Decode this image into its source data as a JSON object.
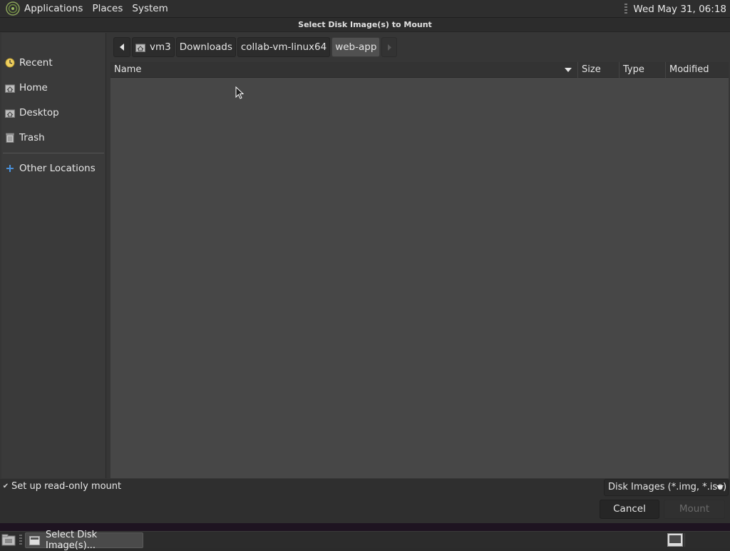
{
  "top_panel": {
    "menus": [
      "Applications",
      "Places",
      "System"
    ],
    "clock": "Wed May 31, 06:18"
  },
  "dialog": {
    "title": "Select Disk Image(s) to Mount",
    "sidebar": {
      "items": [
        {
          "label": "Recent",
          "icon": "recent-icon"
        },
        {
          "label": "Home",
          "icon": "home-folder-icon"
        },
        {
          "label": "Desktop",
          "icon": "desktop-folder-icon"
        },
        {
          "label": "Trash",
          "icon": "trash-icon"
        },
        {
          "label": "Other Locations",
          "icon": "plus-icon"
        }
      ]
    },
    "pathbar": {
      "segments": [
        "vm3",
        "Downloads",
        "collab-vm-linux64",
        "web-app"
      ],
      "active": "web-app"
    },
    "file_list": {
      "columns": [
        "Name",
        "Size",
        "Type",
        "Modified"
      ],
      "rows": []
    },
    "readonly_checkbox": {
      "label": "Set up read-only mount",
      "checked": true
    },
    "filter": {
      "selected": "Disk Images (*.img, *.iso)"
    },
    "buttons": {
      "cancel": "Cancel",
      "mount": "Mount"
    }
  },
  "taskbar": {
    "tasks": [
      {
        "label": "Select Disk Image(s)..."
      }
    ]
  },
  "colors": {
    "panel_bg": "#2e2e2e",
    "dialog_bg": "#363636",
    "list_bg": "#474747",
    "sidebar_bg": "#3a3a3a",
    "accent_blue": "#4a90d9"
  }
}
